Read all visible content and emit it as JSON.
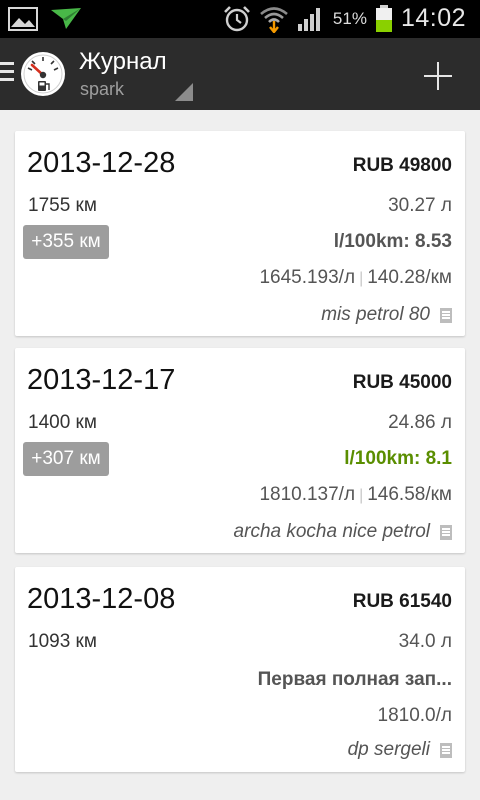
{
  "status_bar": {
    "battery_percent": "51%",
    "time": "14:02",
    "icons": [
      "image-icon",
      "paper-plane-icon",
      "alarm-icon",
      "wifi-icon",
      "signal-icon",
      "battery-icon"
    ],
    "colors": {
      "battery": "#8ad000",
      "download_arrow": "#f59a00"
    }
  },
  "action_bar": {
    "title": "Журнал",
    "subtitle": "spark",
    "icons": [
      "drawer-menu-icon",
      "fuel-gauge-icon",
      "spinner-triangle-icon",
      "add-icon"
    ]
  },
  "entries": [
    {
      "date": "2013-12-28",
      "amount": "RUB 49800",
      "odometer": "1755 км",
      "volume": "30.27 л",
      "distance_badge": "+355 км",
      "consumption": "l/100km: 8.53",
      "consumption_color": "#555555",
      "price_per_liter": "1645.193/л",
      "price_per_km": "140.28/км",
      "station": "mis petrol 80"
    },
    {
      "date": "2013-12-17",
      "amount": "RUB 45000",
      "odometer": "1400 км",
      "volume": "24.86 л",
      "distance_badge": "+307 км",
      "consumption": "l/100km: 8.1",
      "consumption_color": "#5a8e00",
      "price_per_liter": "1810.137/л",
      "price_per_km": "146.58/км",
      "station": "archa kocha nice petrol"
    },
    {
      "date": "2013-12-08",
      "amount": "RUB 61540",
      "odometer": "1093 км",
      "volume": "34.0 л",
      "note": "Первая полная зап...",
      "price_per_liter": "1810.0/л",
      "station": "dp sergeli"
    }
  ]
}
